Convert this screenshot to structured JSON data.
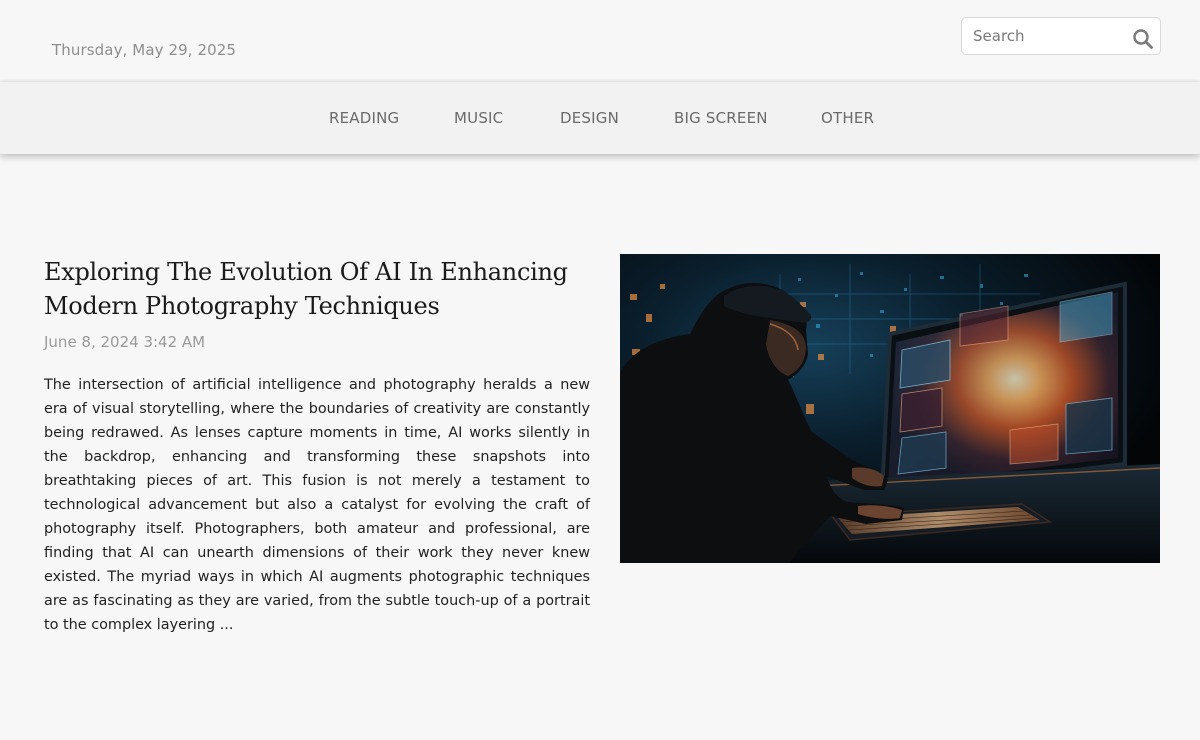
{
  "header": {
    "date": "Thursday, May 29, 2025",
    "search": {
      "placeholder": "Search"
    }
  },
  "nav": {
    "items": [
      {
        "label": "READING"
      },
      {
        "label": "MUSIC"
      },
      {
        "label": "DESIGN"
      },
      {
        "label": "BIG SCREEN"
      },
      {
        "label": "OTHER"
      }
    ]
  },
  "article": {
    "title": "Exploring The Evolution Of AI In Enhancing Modern Photography Techniques",
    "date": "June 8, 2024 3:42 AM",
    "excerpt": "The intersection of artificial intelligence and photography heralds a new era of visual storytelling, where the boundaries of creativity are constantly being redrawed. As lenses capture moments in time, AI works silently in the backdrop, enhancing and transforming these snapshots into breathtaking pieces of art. This fusion is not merely a testament to technological advancement but also a catalyst for evolving the craft of photography itself. Photographers, both amateur and professional, are finding that AI can unearth dimensions of their work they never knew existed. The myriad ways in which AI augments photographic techniques are as fascinating as they are varied, from the subtle touch-up of a portrait to the complex layering ..."
  },
  "colors": {
    "page_background": "#f7f7f7",
    "nav_background": "#f2f2f2",
    "nav_text": "#6a6a6a",
    "date_text": "#8e8e8e",
    "body_text": "#222222"
  }
}
